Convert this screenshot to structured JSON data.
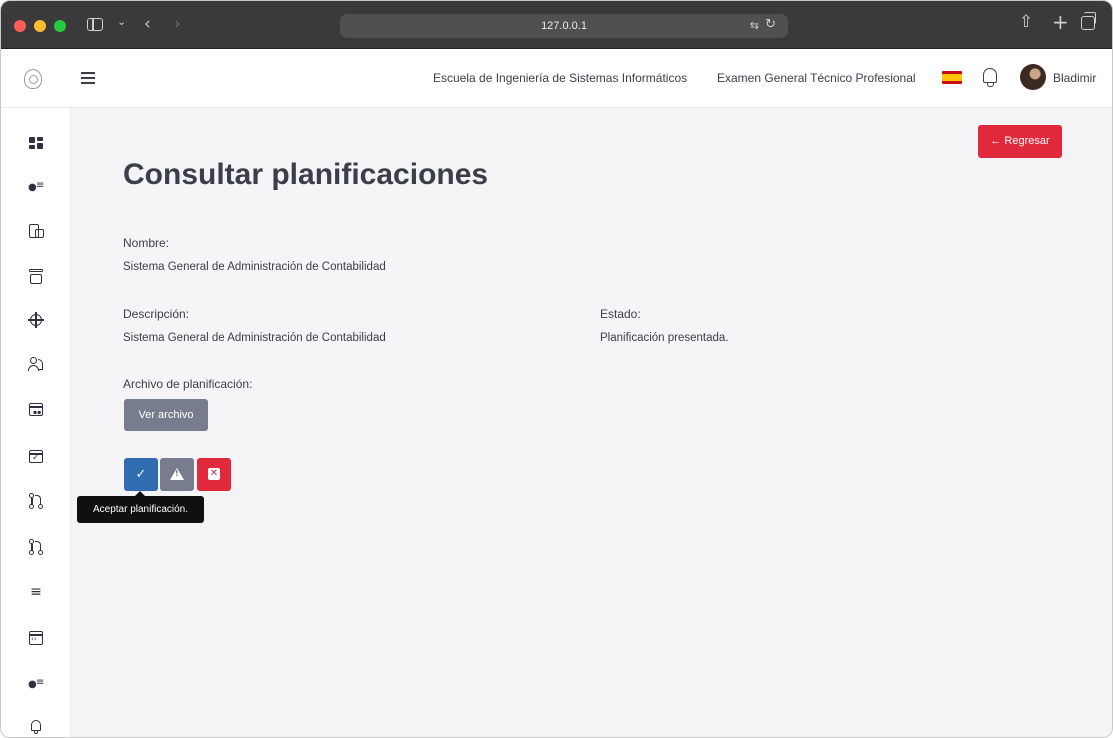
{
  "browser": {
    "address": "127.0.0.1"
  },
  "topbar": {
    "school_link": "Escuela de Ingeniería de Sistemas Informáticos",
    "exam_link": "Examen General Técnico Profesional",
    "user_name": "Bladimir"
  },
  "page": {
    "back_button": "← Regresar",
    "title": "Consultar planificaciones",
    "name_label": "Nombre:",
    "name_value": "Sistema General de Administración de Contabilidad",
    "description_label": "Descripción:",
    "description_value": "Sistema General de Administración de Contabilidad",
    "status_label": "Estado:",
    "status_value": "Planificación presentada.",
    "file_label": "Archivo de planificación:",
    "file_button": "Ver archivo",
    "tooltip": "Aceptar planificación."
  },
  "sidebar": {
    "items": [
      "dashboard-icon",
      "user-list-icon",
      "building-icon",
      "archive-icon",
      "crosshair-icon",
      "users-icon",
      "calendar-icon",
      "calendar-check-icon",
      "git-pull-request-icon",
      "git-pull-request-icon",
      "list-icon",
      "code-window-icon",
      "user-list-icon",
      "bell-icon"
    ]
  },
  "colors": {
    "danger": "#e0293b",
    "primary": "#2f6db0",
    "secondary": "#777d8f",
    "background": "#f5f5f7"
  }
}
